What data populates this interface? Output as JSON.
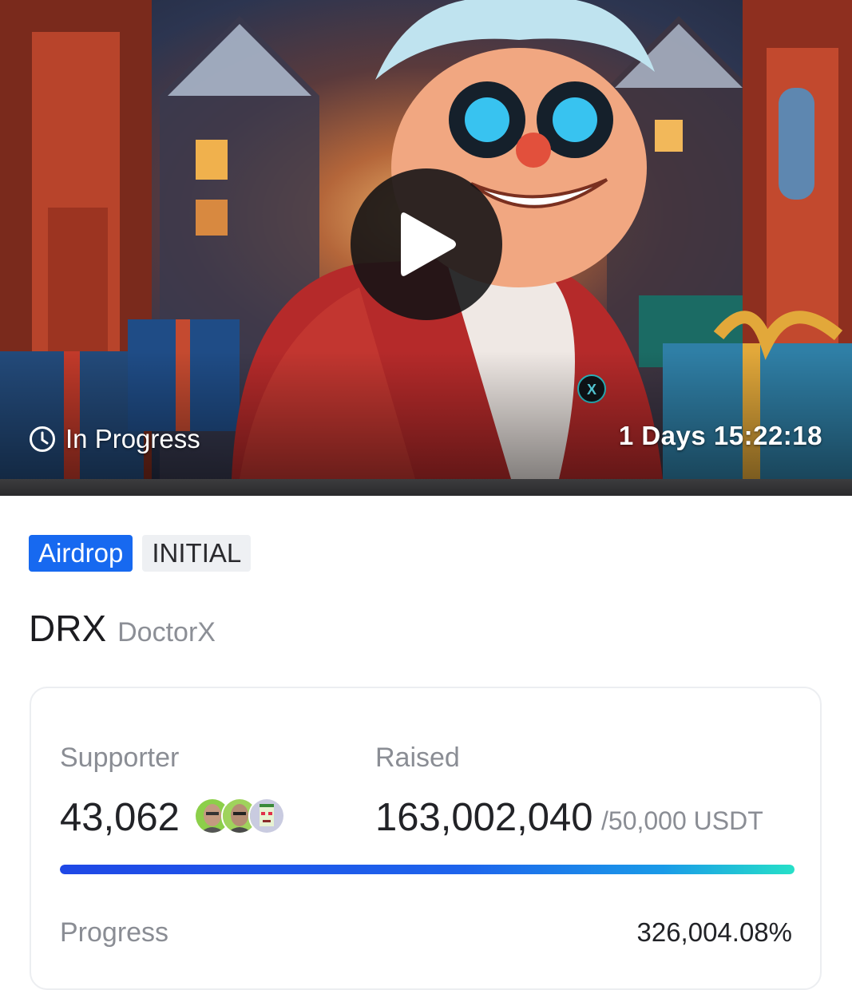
{
  "hero": {
    "status_label": "In Progress",
    "status_icon": "clock-icon",
    "countdown": "1 Days 15:22:18",
    "play_icon": "play-icon",
    "character_badge": "X"
  },
  "tags": {
    "primary": "Airdrop",
    "secondary": "INITIAL",
    "primary_color": "#1769f0"
  },
  "token": {
    "symbol": "DRX",
    "name": "DoctorX"
  },
  "stats": {
    "supporter_label": "Supporter",
    "supporter_count": "43,062",
    "raised_label": "Raised",
    "raised_amount": "163,002,040",
    "raised_goal": "/50,000 USDT",
    "progress_label": "Progress",
    "progress_percent": "326,004.08%",
    "progress_fill_fraction": 1.0
  },
  "colors": {
    "accent": "#1769f0",
    "progress_start": "#1f48e6",
    "progress_end": "#26e0c8"
  }
}
